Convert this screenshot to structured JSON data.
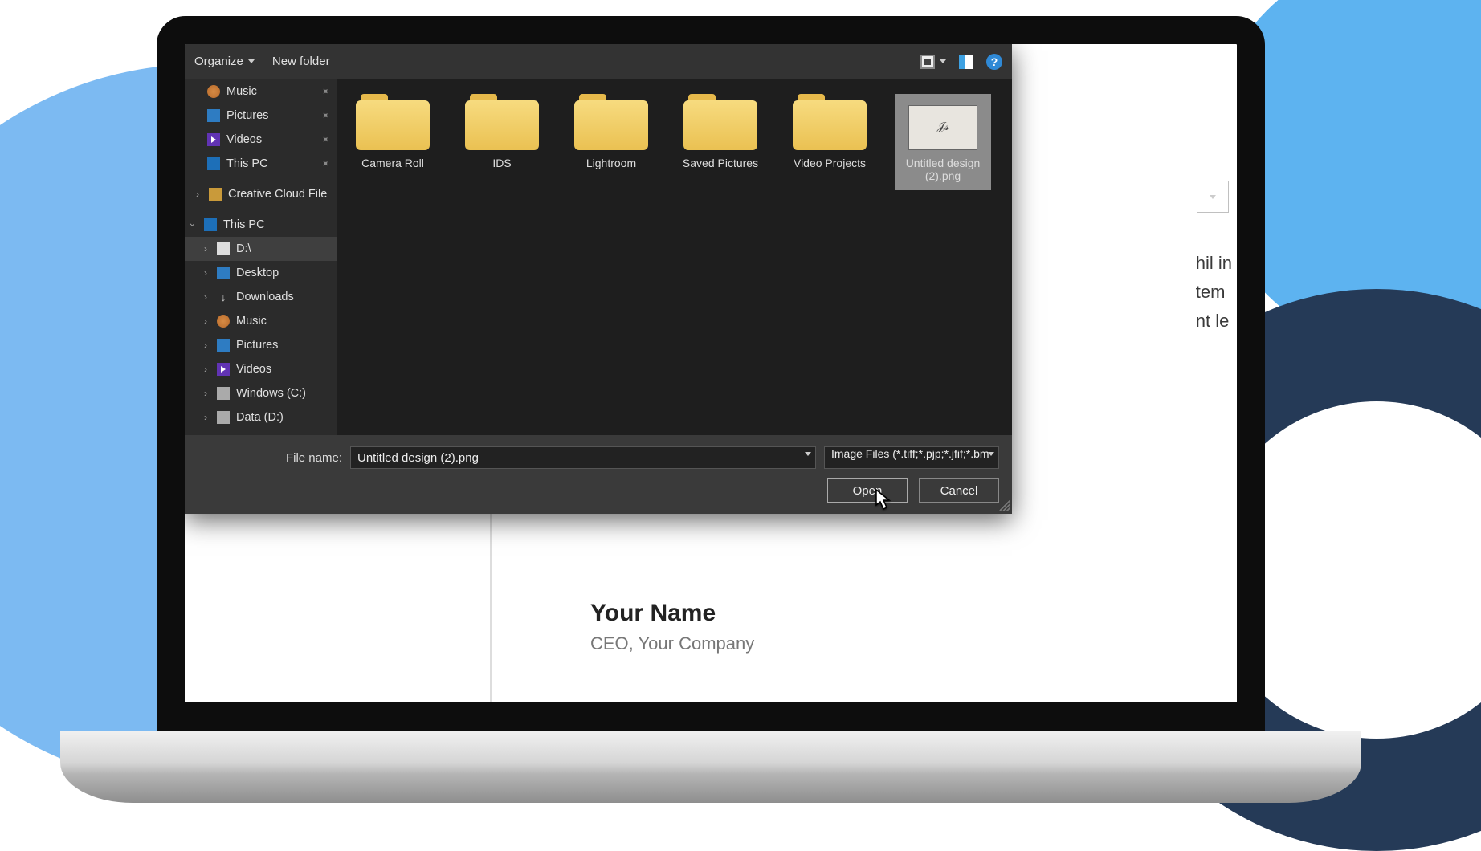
{
  "toolbar": {
    "organize": "Organize",
    "new_folder": "New folder"
  },
  "sidebar": {
    "pinned": [
      {
        "label": "Music",
        "icon": "music"
      },
      {
        "label": "Pictures",
        "icon": "pictures"
      },
      {
        "label": "Videos",
        "icon": "videos"
      },
      {
        "label": "This PC",
        "icon": "pc"
      }
    ],
    "cloud": {
      "label": "Creative Cloud File"
    },
    "thispc_label": "This PC",
    "tree": [
      {
        "label": "D:\\",
        "icon": "doc",
        "selected": true
      },
      {
        "label": "Desktop",
        "icon": "desktop"
      },
      {
        "label": "Downloads",
        "icon": "downloads"
      },
      {
        "label": "Music",
        "icon": "music"
      },
      {
        "label": "Pictures",
        "icon": "pictures"
      },
      {
        "label": "Videos",
        "icon": "videos"
      },
      {
        "label": "Windows (C:)",
        "icon": "drive"
      },
      {
        "label": "Data (D:)",
        "icon": "drive"
      }
    ]
  },
  "files": {
    "folders": [
      "Camera Roll",
      "IDS",
      "Lightroom",
      "Saved Pictures",
      "Video Projects"
    ],
    "selected_file": "Untitled design (2).png"
  },
  "footer": {
    "filename_label": "File name:",
    "filename_value": "Untitled design (2).png",
    "filter_value": "Image Files (*.tiff;*.pjp;*.jfif;*.bm",
    "open": "Open",
    "cancel": "Cancel"
  },
  "document": {
    "line1": "hil in",
    "line2": "tem",
    "line3": "nt le",
    "name": "Your Name",
    "title": "CEO, Your Company"
  }
}
